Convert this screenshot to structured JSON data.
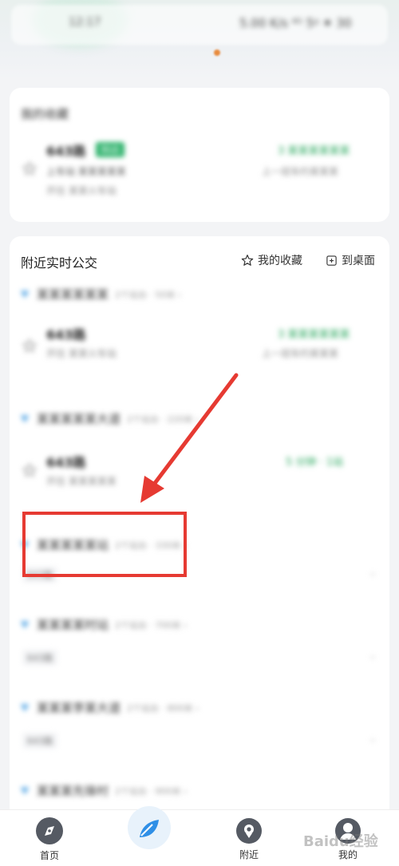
{
  "map": {
    "time_text": "12:17",
    "status_text": "5.00 K/s ⁴ᴳ 5ᵍ ⁕ 30"
  },
  "favorites": {
    "header": "我的收藏",
    "route": {
      "number": "643路",
      "tag": "到达",
      "subtitle": "上车站 某某某某某",
      "meta": "开往 某某火车站",
      "arrival": "3 某某某某某某",
      "detail": "上一班车约某某某"
    }
  },
  "nearby": {
    "title": "附近实时公交",
    "actions": {
      "favorite": "我的收藏",
      "desktop": "到桌面"
    },
    "stations": [
      {
        "name": "某某某某某某",
        "meta": "2个站台 · 50米 ›",
        "route": "643路",
        "route_meta": "开往 某某火车站",
        "arrival": "3 某某某某某某",
        "detail": "上一班车约某某某"
      },
      {
        "name": "某某某某某大道",
        "meta": "2个站台 · 220米 ›",
        "route": "643路",
        "route_meta": "开往 某某某某某",
        "arrival": "5 分钟 · 1站",
        "detail": ""
      },
      {
        "name": "某某某某某站",
        "meta": "2个站台 · 330米 ›",
        "chip": "643路"
      },
      {
        "name": "某某某某时站",
        "meta": "2个站台 · 700米 ›",
        "chip": "643路"
      },
      {
        "name": "某某某李某大道",
        "meta": "2个站台 · 800米 ›",
        "chip": "643路"
      },
      {
        "name": "某某某先锋村",
        "meta": "2个站台 · 900米 ›"
      }
    ]
  },
  "tabs": [
    {
      "label": "首页",
      "icon": "compass-icon"
    },
    {
      "label": "",
      "icon": "leaf-icon"
    },
    {
      "label": "附近",
      "icon": "location-pin-icon"
    },
    {
      "label": "我的",
      "icon": "avatar-icon"
    }
  ],
  "watermark": "Baidu经验",
  "colors": {
    "accent_green": "#26a65b",
    "annotation_red": "#e63a32",
    "leaf_blue": "#2f8fe6"
  }
}
